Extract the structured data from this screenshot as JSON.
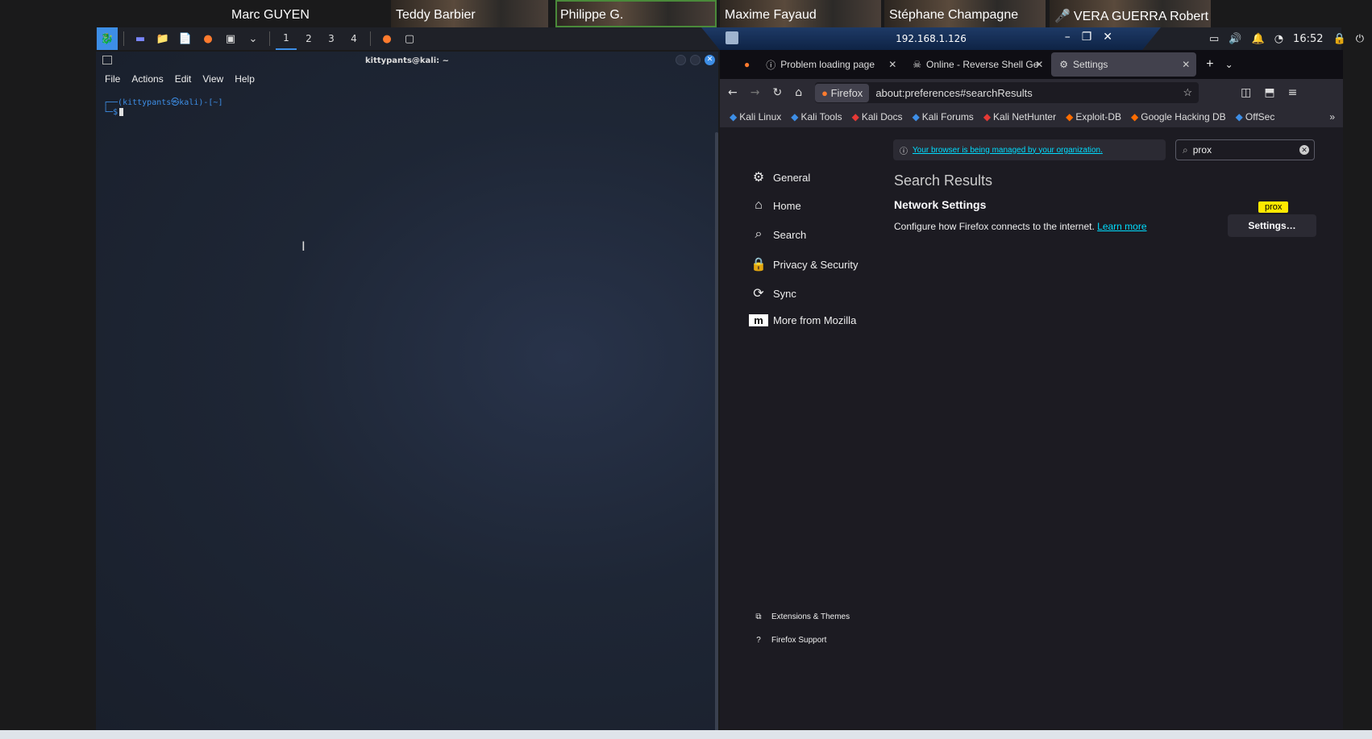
{
  "participants": [
    {
      "name": "Marc GUYEN",
      "muted": false
    },
    {
      "name": "Teddy Barbier",
      "muted": false
    },
    {
      "name": "Philippe G.",
      "muted": false
    },
    {
      "name": "Maxime Fayaud",
      "muted": false
    },
    {
      "name": "Stéphane Champagne",
      "muted": false
    },
    {
      "name": "VERA GUERRA Robert ...",
      "muted": true
    }
  ],
  "taskbar": {
    "workspaces": [
      "1",
      "2",
      "3",
      "4"
    ],
    "active_workspace": "1"
  },
  "remote": {
    "address": "192.168.1.126"
  },
  "tray": {
    "time": "16:52"
  },
  "terminal": {
    "title": "kittypants@kali: ~",
    "menu": [
      "File",
      "Actions",
      "Edit",
      "View",
      "Help"
    ],
    "prompt_line1": "┌──(kittypants㉿kali)-[~]",
    "prompt_line2": "└─$"
  },
  "firefox": {
    "tabs": [
      {
        "label": "Problem loading page",
        "icon": "info-icon"
      },
      {
        "label": "Online - Reverse Shell Ge",
        "icon": "skull-icon"
      },
      {
        "label": "Settings",
        "icon": "gear-icon"
      }
    ],
    "url_badge": "Firefox",
    "url": "about:preferences#searchResults",
    "bookmarks": [
      "Kali Linux",
      "Kali Tools",
      "Kali Docs",
      "Kali Forums",
      "Kali NetHunter",
      "Exploit-DB",
      "Google Hacking DB",
      "OffSec"
    ],
    "managed_notice": "Your browser is being managed by your organization.",
    "search_value": "prox",
    "categories": [
      "General",
      "Home",
      "Search",
      "Privacy & Security",
      "Sync",
      "More from Mozilla"
    ],
    "results_title": "Search Results",
    "result_heading": "Network Settings",
    "result_desc": "Configure how Firefox connects to the internet.",
    "learn_more": "Learn more",
    "highlight_badge": "prox",
    "settings_button": "Settings…",
    "footer": [
      "Extensions & Themes",
      "Firefox Support"
    ]
  },
  "colors": {
    "accent": "#3d8ee6",
    "link": "#00ddff",
    "highlight": "#ffe900"
  }
}
